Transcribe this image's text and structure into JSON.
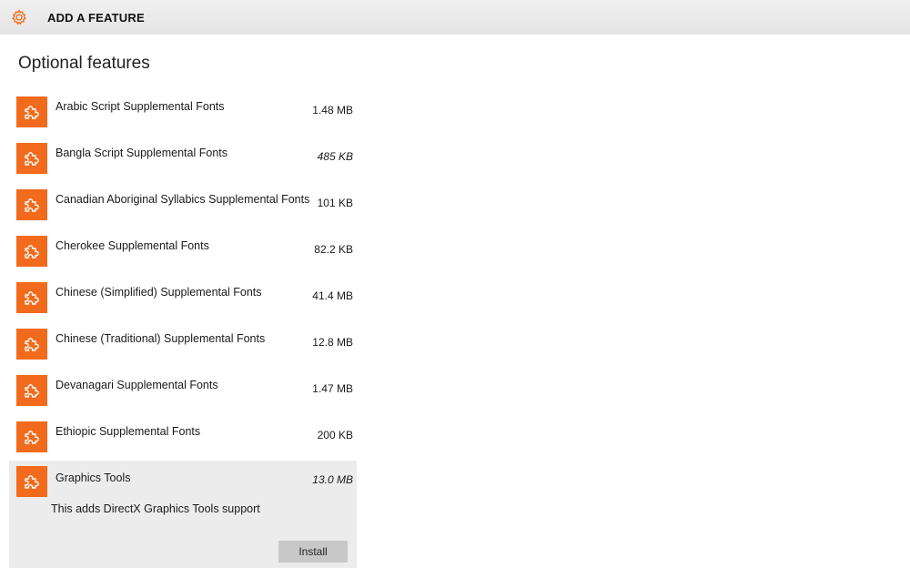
{
  "window": {
    "title": "ADD A FEATURE"
  },
  "page": {
    "heading": "Optional features"
  },
  "colors": {
    "accent": "#f26a1b",
    "titlebar": "#e8e8e8",
    "selected_row": "#ececec",
    "install_button": "#c8c8c8"
  },
  "features": [
    {
      "name": "Arabic Script Supplemental Fonts",
      "size": "1.48 MB"
    },
    {
      "name": "Bangla Script Supplemental Fonts",
      "size": "485 KB"
    },
    {
      "name": "Canadian Aboriginal Syllabics Supplemental Fonts",
      "size": "101 KB"
    },
    {
      "name": "Cherokee Supplemental Fonts",
      "size": "82.2 KB"
    },
    {
      "name": "Chinese (Simplified) Supplemental Fonts",
      "size": "41.4 MB"
    },
    {
      "name": "Chinese (Traditional) Supplemental Fonts",
      "size": "12.8 MB"
    },
    {
      "name": "Devanagari Supplemental Fonts",
      "size": "1.47 MB"
    },
    {
      "name": "Ethiopic Supplemental Fonts",
      "size": "200 KB"
    },
    {
      "name": "Graphics Tools",
      "size": "13.0 MB",
      "description": "This adds DirectX Graphics Tools support",
      "install_label": "Install"
    }
  ]
}
